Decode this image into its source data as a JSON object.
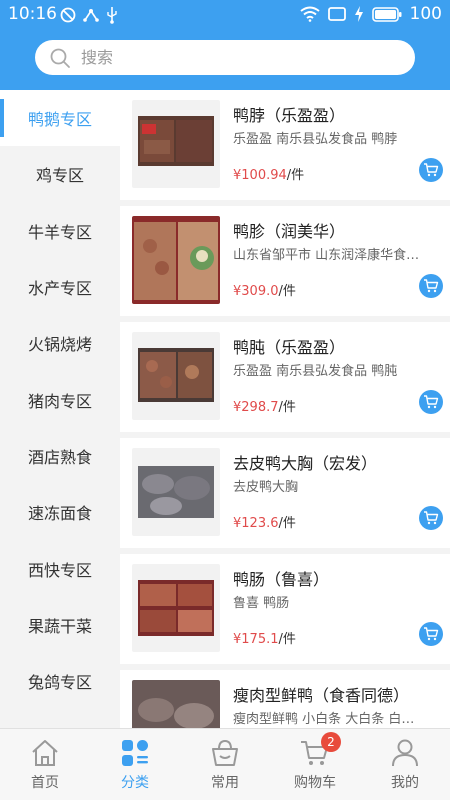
{
  "status": {
    "time": "10:16",
    "battery": "100"
  },
  "search": {
    "placeholder": "搜索"
  },
  "sidebar": {
    "items": [
      {
        "label": "鸭鹅专区",
        "active": true
      },
      {
        "label": "鸡专区"
      },
      {
        "label": "牛羊专区"
      },
      {
        "label": "水产专区"
      },
      {
        "label": "火锅烧烤"
      },
      {
        "label": "猪肉专区"
      },
      {
        "label": "酒店熟食"
      },
      {
        "label": "速冻面食"
      },
      {
        "label": "西快专区"
      },
      {
        "label": "果蔬干菜"
      },
      {
        "label": "兔鸽专区"
      }
    ]
  },
  "products": [
    {
      "name": "鸭脖（乐盈盈）",
      "desc": "乐盈盈 南乐县弘发食品 鸭脖",
      "price": "¥100.94",
      "unit": "/件"
    },
    {
      "name": "鸭胗（润美华）",
      "desc": "山东省邹平市 山东润泽康华食…",
      "price": "¥309.0",
      "unit": "/件"
    },
    {
      "name": "鸭肫（乐盈盈）",
      "desc": "乐盈盈 南乐县弘发食品 鸭肫",
      "price": "¥298.7",
      "unit": "/件"
    },
    {
      "name": "去皮鸭大胸（宏发）",
      "desc": "去皮鸭大胸",
      "price": "¥123.6",
      "unit": "/件"
    },
    {
      "name": "鸭肠（鲁喜）",
      "desc": "鲁喜 鸭肠",
      "price": "¥175.1",
      "unit": "/件"
    },
    {
      "name": "瘦肉型鲜鸭（食香同德）",
      "desc": "瘦肉型鲜鸭 小白条 大白条 白…",
      "price": "",
      "unit": ""
    }
  ],
  "tabbar": {
    "items": [
      {
        "label": "首页",
        "icon": "home-icon"
      },
      {
        "label": "分类",
        "icon": "category-icon",
        "active": true
      },
      {
        "label": "常用",
        "icon": "basket-icon"
      },
      {
        "label": "购物车",
        "icon": "cart-icon",
        "badge": "2"
      },
      {
        "label": "我的",
        "icon": "user-icon"
      }
    ]
  },
  "colors": {
    "primary": "#3da0f0",
    "price": "#e04b4b",
    "badge": "#e84b3c"
  }
}
